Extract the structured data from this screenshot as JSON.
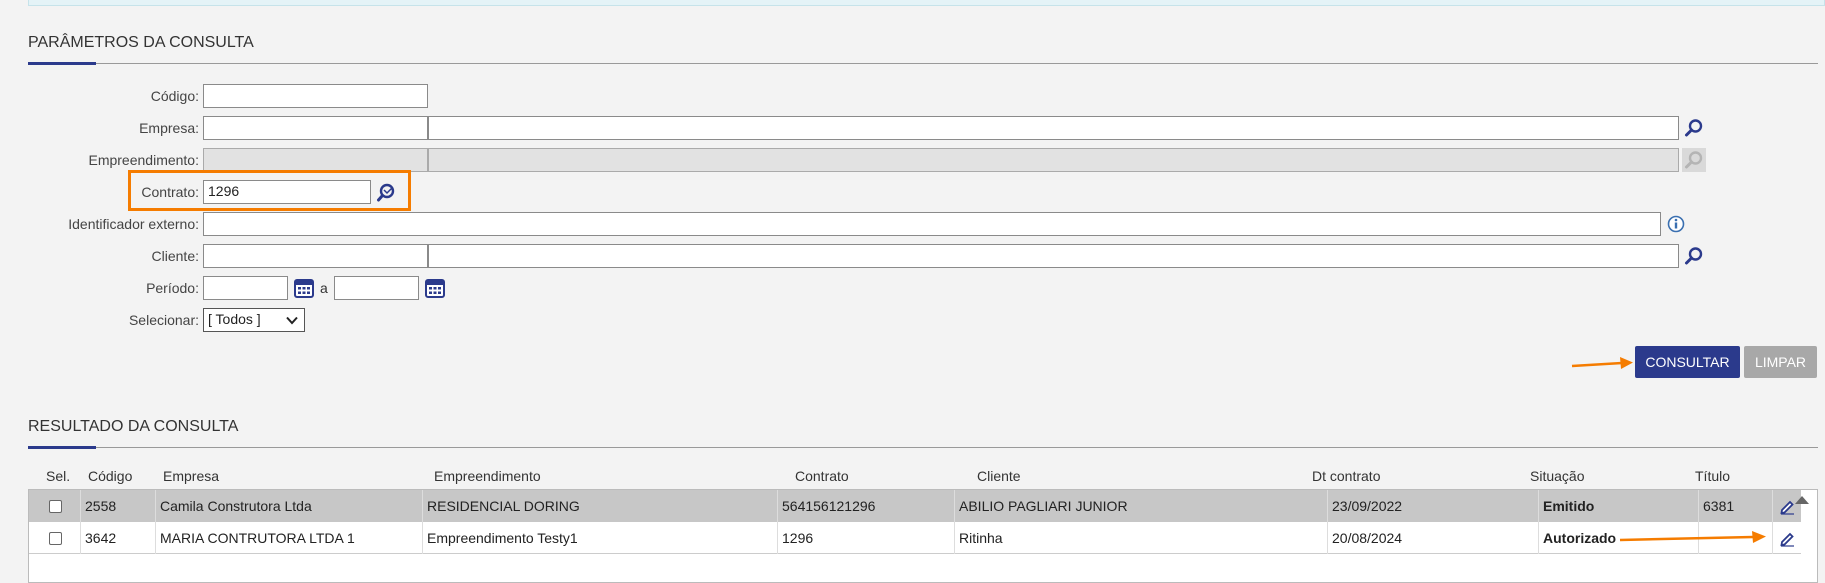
{
  "params": {
    "title": "PARÂMETROS DA CONSULTA",
    "labels": {
      "codigo": "Código:",
      "empresa": "Empresa:",
      "empreendimento": "Empreendimento:",
      "contrato": "Contrato:",
      "identificador": "Identificador externo:",
      "cliente": "Cliente:",
      "periodo": "Período:",
      "periodo_sep": "a",
      "selecionar": "Selecionar:"
    },
    "values": {
      "codigo": "",
      "empresa_code": "",
      "empresa_name": "",
      "contrato": "1296",
      "identificador": "",
      "cliente_code": "",
      "cliente_name": "",
      "periodo_inicio": "",
      "periodo_fim": "",
      "selecionar": "[ Todos ]"
    },
    "buttons": {
      "consultar": "CONSULTAR",
      "limpar": "LIMPAR"
    }
  },
  "results": {
    "title": "RESULTADO DA CONSULTA",
    "columns": [
      "Sel.",
      "Código",
      "Empresa",
      "Empreendimento",
      "Contrato",
      "Cliente",
      "Dt contrato",
      "Situação",
      "Título"
    ],
    "rows": [
      {
        "codigo": "2558",
        "empresa": "Camila Construtora Ltda",
        "empreendimento": "RESIDENCIAL DORING",
        "contrato": "564156121296",
        "cliente": "ABILIO PAGLIARI JUNIOR",
        "dt": "23/09/2022",
        "situacao": "Emitido",
        "titulo": "6381"
      },
      {
        "codigo": "3642",
        "empresa": "MARIA CONTRUTORA LTDA 1",
        "empreendimento": "Empreendimento Testy1",
        "contrato": "1296",
        "cliente": "Ritinha",
        "dt": "20/08/2024",
        "situacao": "Autorizado",
        "titulo": ""
      }
    ]
  },
  "colors": {
    "primary": "#2b3a8c",
    "highlight": "#f57c00",
    "row_selected": "#c7c7c7"
  },
  "icons": [
    "search-icon",
    "calendar-icon",
    "info-icon",
    "edit-icon",
    "scroll-up-icon",
    "arrow-annotation"
  ]
}
